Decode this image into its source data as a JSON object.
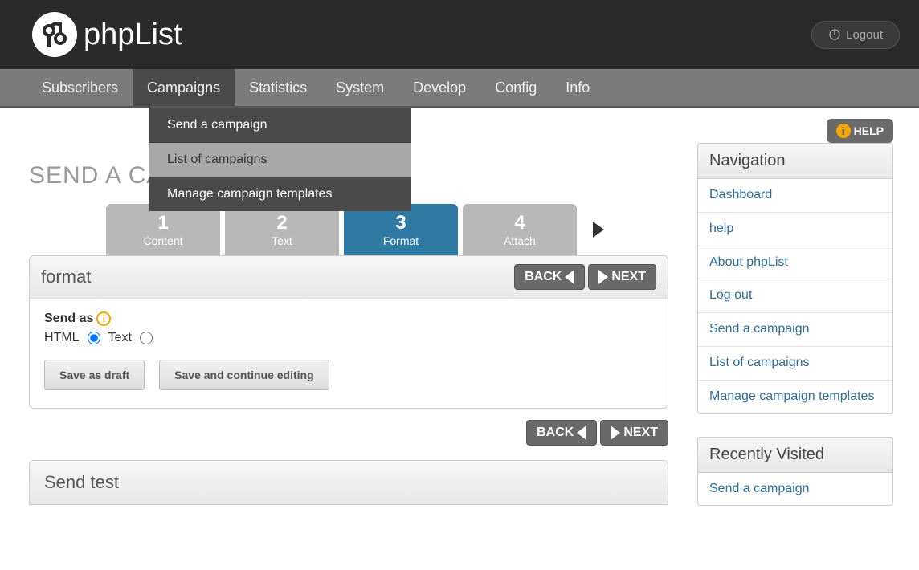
{
  "header": {
    "app_name": "phpList",
    "logout_label": "Logout"
  },
  "mainnav": {
    "items": [
      "Subscribers",
      "Campaigns",
      "Statistics",
      "System",
      "Develop",
      "Config",
      "Info"
    ],
    "active_index": 1
  },
  "dropdown": {
    "items": [
      "Send a campaign",
      "List of campaigns",
      "Manage campaign templates"
    ],
    "hover_index": 1
  },
  "help_label": "HELP",
  "page_title": "SEND A CAMPAIGN",
  "wizard": {
    "steps": [
      {
        "num": "1",
        "label": "Content"
      },
      {
        "num": "2",
        "label": "Text"
      },
      {
        "num": "3",
        "label": "Format"
      },
      {
        "num": "4",
        "label": "Attach"
      }
    ],
    "active_index": 2
  },
  "panel": {
    "title": "format",
    "back_label": "BACK",
    "next_label": "NEXT",
    "send_as_label": "Send as",
    "opt_html": "HTML",
    "opt_text": "Text",
    "btn_draft": "Save as draft",
    "btn_continue": "Save and continue editing"
  },
  "panel2": {
    "title": "Send test"
  },
  "sidebar": {
    "nav_title": "Navigation",
    "nav_items": [
      "Dashboard",
      "help",
      "About phpList",
      "Log out",
      "Send a campaign",
      "List of campaigns",
      "Manage campaign templates"
    ],
    "recent_title": "Recently Visited",
    "recent_items": [
      "Send a campaign"
    ]
  }
}
